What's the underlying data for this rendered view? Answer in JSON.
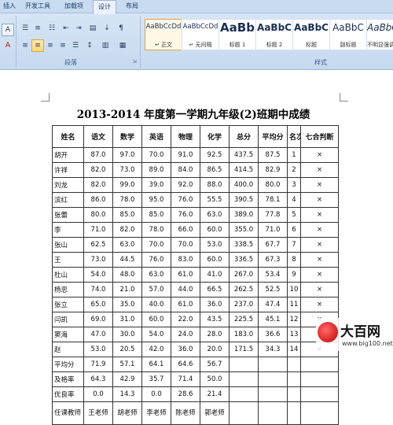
{
  "ribbon": {
    "tabs": [
      {
        "label": "插入"
      },
      {
        "label": "开发工具"
      },
      {
        "label": "加载项"
      },
      {
        "label": "设计",
        "active": true
      },
      {
        "label": "布局"
      }
    ],
    "groups": {
      "paragraph_label": "段落",
      "styles_label": "样式"
    },
    "styles": [
      {
        "sample": "AaBbCcDd",
        "name": "↵ 正文"
      },
      {
        "sample": "AaBbCcDd",
        "name": "↵ 无间隔"
      },
      {
        "sample": "AaBb",
        "name": "标题 1"
      },
      {
        "sample": "AaBbC",
        "name": "标题 2"
      },
      {
        "sample": "AaBbC",
        "name": "标题"
      },
      {
        "sample": "AaBbC",
        "name": "副标题"
      },
      {
        "sample": "AaBbC",
        "name": "不明显强调"
      }
    ]
  },
  "document": {
    "title": "2013-2014 年度第一学期九年级(2)班期中成绩",
    "headers": [
      "姓名",
      "语文",
      "数学",
      "英语",
      "物理",
      "化学",
      "总分",
      "平均分",
      "名次",
      "七合判断"
    ],
    "rows": [
      [
        "胡开",
        "87.0",
        "97.0",
        "70.0",
        "91.0",
        "92.5",
        "437.5",
        "87.5",
        "1",
        "×"
      ],
      [
        "许祥",
        "82.0",
        "73.0",
        "89.0",
        "84.0",
        "86.5",
        "414.5",
        "82.9",
        "2",
        "×"
      ],
      [
        "刘龙",
        "82.0",
        "99.0",
        "39.0",
        "92.0",
        "88.0",
        "400.0",
        "80.0",
        "3",
        "×"
      ],
      [
        "滨红",
        "86.0",
        "78.0",
        "95.0",
        "76.0",
        "55.5",
        "390.5",
        "78.1",
        "4",
        "×"
      ],
      [
        "张蕾",
        "80.0",
        "85.0",
        "85.0",
        "76.0",
        "63.0",
        "389.0",
        "77.8",
        "5",
        "×"
      ],
      [
        "李",
        "71.0",
        "82.0",
        "78.0",
        "66.0",
        "60.0",
        "355.0",
        "71.0",
        "6",
        "×"
      ],
      [
        "张山",
        "62.5",
        "63.0",
        "70.0",
        "70.0",
        "53.0",
        "338.5",
        "67.7",
        "7",
        "×"
      ],
      [
        "王",
        "73.0",
        "44.5",
        "76.0",
        "83.0",
        "60.0",
        "336.5",
        "67.3",
        "8",
        "×"
      ],
      [
        "杜山",
        "54.0",
        "48.0",
        "63.0",
        "61.0",
        "41.0",
        "267.0",
        "53.4",
        "9",
        "×"
      ],
      [
        "杨忠",
        "74.0",
        "21.0",
        "57.0",
        "44.0",
        "66.5",
        "262.5",
        "52.5",
        "10",
        "×"
      ],
      [
        "张立",
        "65.0",
        "35.0",
        "40.0",
        "61.0",
        "36.0",
        "237.0",
        "47.4",
        "11",
        "×"
      ],
      [
        "闫凯",
        "69.0",
        "31.0",
        "60.0",
        "22.0",
        "43.5",
        "225.5",
        "45.1",
        "12",
        "×"
      ],
      [
        "窦海",
        "47.0",
        "30.0",
        "54.0",
        "24.0",
        "28.0",
        "183.0",
        "36.6",
        "13",
        "×"
      ],
      [
        "赵",
        "53.0",
        "20.5",
        "42.0",
        "36.0",
        "20.0",
        "171.5",
        "34.3",
        "14",
        "×"
      ],
      [
        "平均分",
        "71.9",
        "57.1",
        "64.1",
        "64.6",
        "56.7",
        "",
        "",
        "",
        ""
      ],
      [
        "及格率",
        "64.3",
        "42.9",
        "35.7",
        "71.4",
        "50.0",
        "",
        "",
        "",
        ""
      ],
      [
        "优良率",
        "0.0",
        "14.3",
        "0.0",
        "28.6",
        "21.4",
        "",
        "",
        "",
        ""
      ],
      [
        "任课教师",
        "王老师",
        "胡老师",
        "李老师",
        "陈老师",
        "郭老师",
        "",
        "",
        "",
        ""
      ]
    ]
  },
  "watermark": {
    "name": "大百网",
    "url": "www.big100.net"
  }
}
